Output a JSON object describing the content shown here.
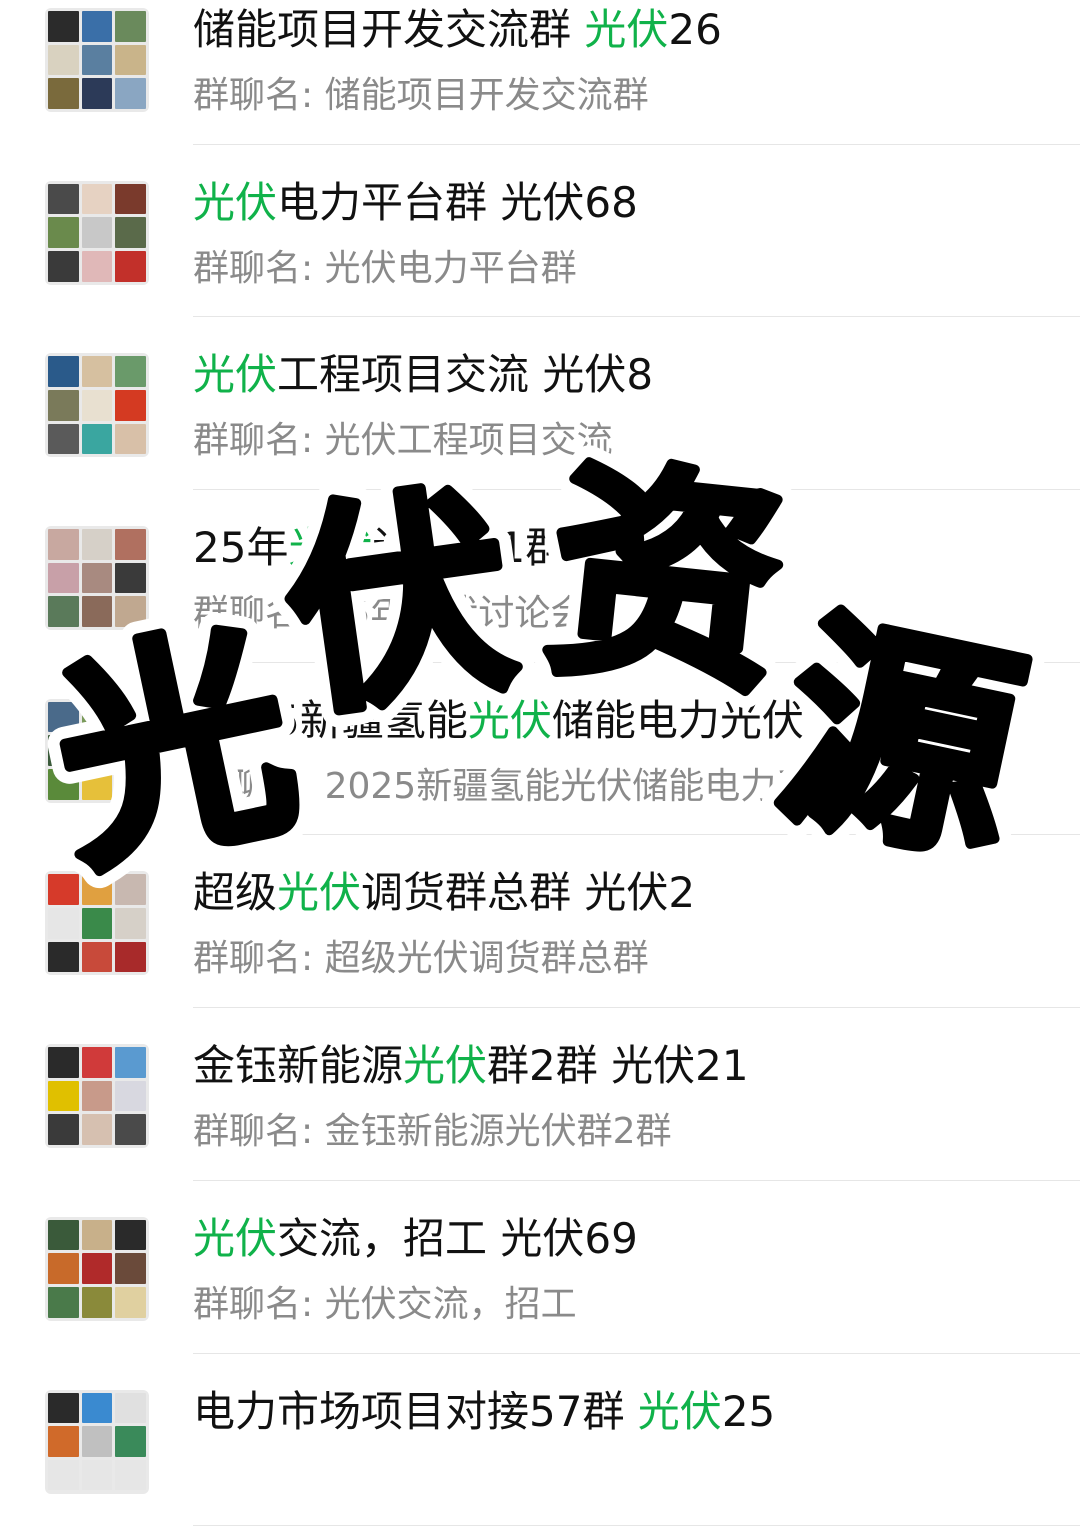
{
  "colors": {
    "highlight": "#10b24a",
    "title": "#111111",
    "subtitle": "#8a8a8a",
    "divider": "#e6e6e6"
  },
  "groups": [
    {
      "title_parts": [
        [
          "储能项目开发交流群 ",
          false
        ],
        [
          "光伏",
          true
        ],
        [
          "26",
          false
        ]
      ],
      "subtitle": "群聊名: 储能项目开发交流群",
      "tiles": [
        "#2b2b2b",
        "#3a6fa8",
        "#6a8a5c",
        "#d9d2c0",
        "#5a7fa0",
        "#c9b48a",
        "#7a6a3c",
        "#2c3a58",
        "#8aa6c2"
      ]
    },
    {
      "title_parts": [
        [
          "光伏",
          true
        ],
        [
          "电力平台群 光伏68",
          false
        ]
      ],
      "subtitle": "群聊名: 光伏电力平台群",
      "tiles": [
        "#4a4a4a",
        "#e6d2c2",
        "#7a3a2c",
        "#6a8a4c",
        "#c8c8c8",
        "#5a6a4a",
        "#3a3a3a",
        "#e0b8b8",
        "#c2302a"
      ]
    },
    {
      "title_parts": [
        [
          "光伏",
          true
        ],
        [
          "工程项目交流 光伏8",
          false
        ]
      ],
      "subtitle": "群聊名: 光伏工程项目交流",
      "tiles": [
        "#2a5a8a",
        "#d6c0a0",
        "#6a9a6a",
        "#7a7a5a",
        "#e8e0d0",
        "#d43a22",
        "#5a5a5a",
        "#3aa6a0",
        "#d8c0a8"
      ]
    },
    {
      "title_parts": [
        [
          "25年",
          false
        ],
        [
          "光伏",
          true
        ],
        [
          "讨论会1群 光伏",
          false
        ]
      ],
      "subtitle": "群聊名: 25年光伏讨论会",
      "tiles": [
        "#c8a8a0",
        "#d6d0c8",
        "#b07060",
        "#c8a0a8",
        "#a88a80",
        "#3a3a3a",
        "#5a7a5a",
        "#8a6a5a",
        "#c0a890"
      ]
    },
    {
      "title_parts": [
        [
          "2025新疆氢能",
          false
        ],
        [
          "光伏",
          true
        ],
        [
          "储能电力光伏",
          false
        ]
      ],
      "subtitle": "群聊名: 2025新疆氢能光伏储能电力采购",
      "tiles": [
        "#4a6a8a",
        "#7a9a5a",
        "#d6b05a",
        "#3a5a3a",
        "#8aa0b0",
        "#c06a4a",
        "#5a8a3a",
        "#e6c03a",
        "#2a4a2a"
      ]
    },
    {
      "title_parts": [
        [
          "超级",
          false
        ],
        [
          "光伏",
          true
        ],
        [
          "调货群总群 光伏2",
          false
        ]
      ],
      "subtitle": "群聊名: 超级光伏调货群总群",
      "tiles": [
        "#d63a2a",
        "#e0a040",
        "#c8b8b0",
        "#e6e6e6",
        "#3a8a4a",
        "#d6d0c8",
        "#2a2a2a",
        "#c84a3a",
        "#a82a2a"
      ]
    },
    {
      "title_parts": [
        [
          "金钰新能源",
          false
        ],
        [
          "光伏",
          true
        ],
        [
          "群2群 光伏21",
          false
        ]
      ],
      "subtitle": "群聊名: 金钰新能源光伏群2群",
      "tiles": [
        "#2a2a2a",
        "#d03a3a",
        "#5a9ad0",
        "#e0c000",
        "#c89a8a",
        "#d8d8e0",
        "#3a3a3a",
        "#d6c0b0",
        "#4a4a4a"
      ]
    },
    {
      "title_parts": [
        [
          "光伏",
          true
        ],
        [
          "交流，招工 光伏69",
          false
        ]
      ],
      "subtitle": "群聊名: 光伏交流，招工",
      "tiles": [
        "#3a5a3a",
        "#c8b08a",
        "#2a2a2a",
        "#c86a2a",
        "#b02a2a",
        "#6a4a3a",
        "#4a7a4a",
        "#8a8a3a",
        "#e0d0a0"
      ]
    },
    {
      "title_parts": [
        [
          "电力市场项目对接57群 ",
          false
        ],
        [
          "光伏",
          true
        ],
        [
          "25",
          false
        ]
      ],
      "subtitle": "",
      "tiles": [
        "#2a2a2a",
        "#3a8ad0",
        "#e0e0e0",
        "#d06a2a",
        "#c0c0c0",
        "#3a8a5a",
        "#e6e6e6",
        "#e6e6e6",
        "#e6e6e6"
      ]
    }
  ],
  "overlay": {
    "chars": [
      "光",
      "伏",
      "资",
      "源"
    ]
  }
}
